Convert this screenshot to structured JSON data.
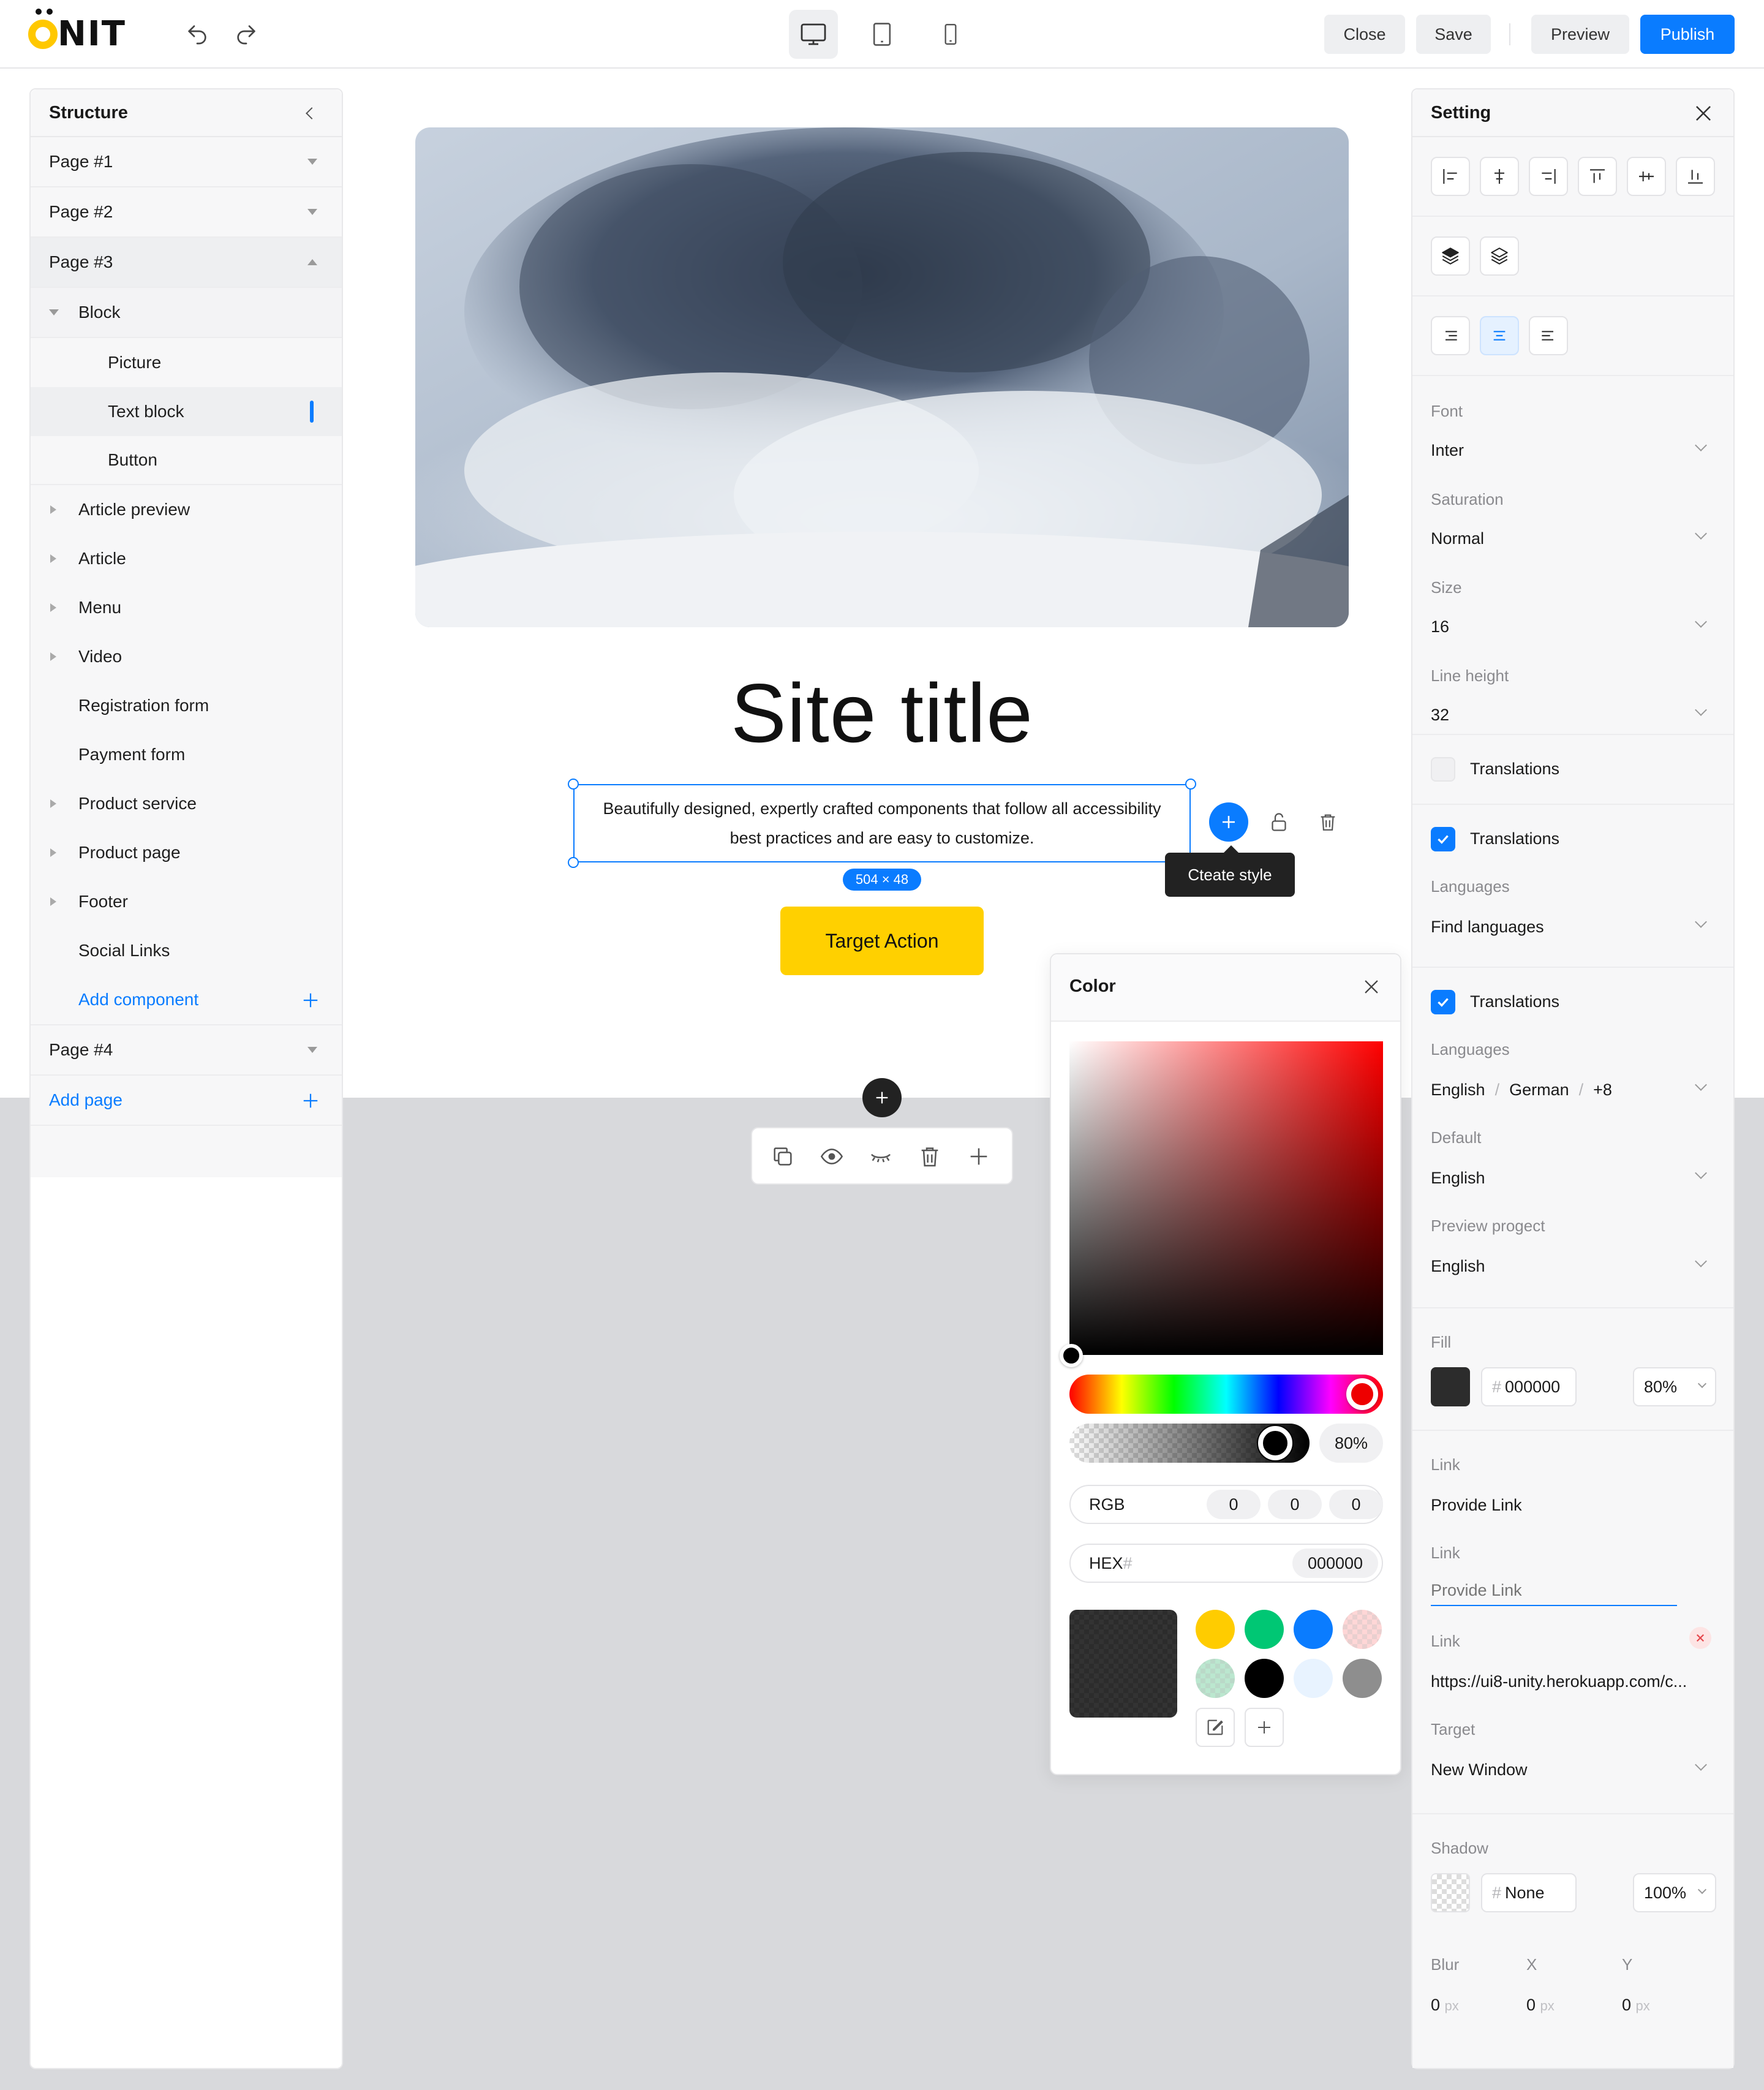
{
  "app": {
    "logo": "ONIT"
  },
  "topbar": {
    "close": "Close",
    "save": "Save",
    "preview": "Preview",
    "publish": "Publish"
  },
  "structure": {
    "title": "Structure",
    "pages": [
      "Page #1",
      "Page #2",
      "Page #3",
      "Page #4"
    ],
    "block": {
      "label": "Block",
      "children": [
        "Picture",
        "Text block",
        "Button"
      ]
    },
    "components": [
      "Article preview",
      "Article",
      "Menu",
      "Video",
      "Registration form",
      "Payment form",
      "Product service",
      "Product page",
      "Footer",
      "Social Links"
    ],
    "add_component": "Add component",
    "add_page": "Add page"
  },
  "canvas": {
    "site_title": "Site title",
    "text_block": "Beautifully designed, expertly crafted components that follow all accessibility best practices and are easy to customize.",
    "dimensions": "504 × 48",
    "cta": "Target Action",
    "tooltip": "Cteate style"
  },
  "color": {
    "title": "Color",
    "opacity": "80%",
    "rgb_label": "RGB",
    "rgb": [
      "0",
      "0",
      "0"
    ],
    "hex_label": "HEX",
    "hex_hash": "#",
    "hex": "000000",
    "swatches": [
      "#ffcc00",
      "#00c774",
      "#0a7cff",
      "checker-pink",
      "checker-green",
      "#000000",
      "#e8f3ff",
      "#8e8e8e"
    ]
  },
  "setting": {
    "title": "Setting",
    "font_label": "Font",
    "font": "Inter",
    "saturation_label": "Saturation",
    "saturation": "Normal",
    "size_label": "Size",
    "size": "16",
    "line_height_label": "Line height",
    "line_height": "32",
    "translations": "Translations",
    "languages_label": "Languages",
    "find_languages": "Find languages",
    "lang1": "English",
    "sep": "/",
    "lang2": "German",
    "more": "+8",
    "default_label": "Default",
    "default": "English",
    "preview_label": "Preview progect",
    "preview": "English",
    "fill_label": "Fill",
    "fill_hash": "#",
    "fill_hex": "000000",
    "fill_opacity": "80%",
    "link_label": "Link",
    "link1": "Provide Link",
    "link2_placeholder": "Provide Link",
    "link3": "https://ui8-unity.herokuapp.com/c...",
    "target_label": "Target",
    "target": "New Window",
    "shadow_label": "Shadow",
    "shadow_value": "None",
    "shadow_opacity": "100%",
    "blur_label": "Blur",
    "x_label": "X",
    "y_label": "Y",
    "blur": "0",
    "x": "0",
    "y": "0",
    "unit": "px"
  },
  "colors": {
    "accent": "#0a7cff",
    "cta": "#ffd000",
    "logo": "#ffc800"
  }
}
